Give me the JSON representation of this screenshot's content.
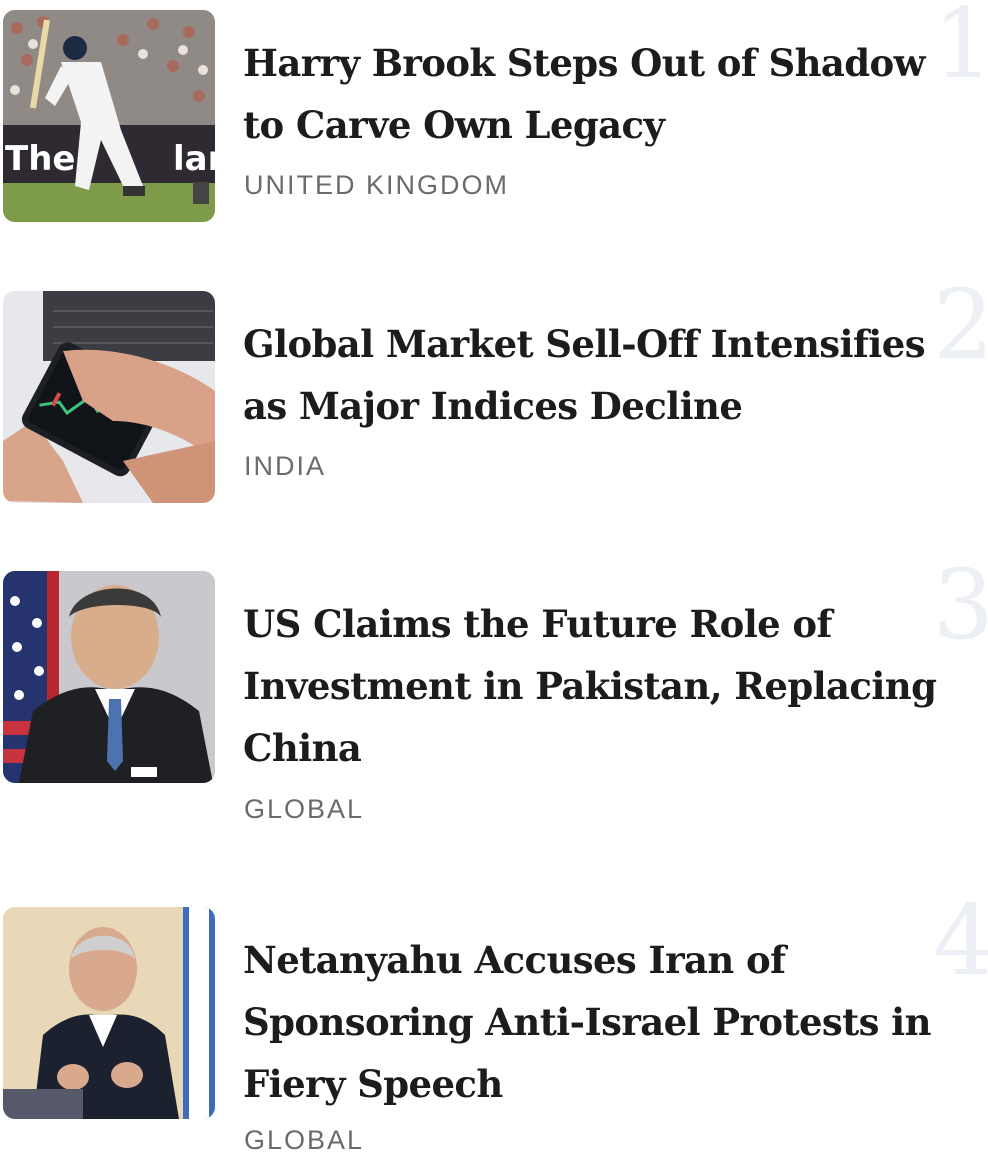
{
  "articles": [
    {
      "rank": "1",
      "headline": "Harry Brook Steps Out of Shadow to Carve Own Legacy",
      "category": "UNITED KINGDOM",
      "image": "cricket-batsman-photo"
    },
    {
      "rank": "2",
      "headline": "Global Market Sell-Off Intensifies as Major Indices Decline",
      "category": "INDIA",
      "image": "stock-chart-phone-photo"
    },
    {
      "rank": "3",
      "headline": "US Claims the Future Role of Investment in Pakistan, Replacing China",
      "category": "GLOBAL",
      "image": "diplomat-portrait-photo"
    },
    {
      "rank": "4",
      "headline": "Netanyahu Accuses Iran of Sponsoring Anti-Israel Protests in Fiery Speech",
      "category": "GLOBAL",
      "image": "speaker-at-podium-photo"
    }
  ],
  "colors": {
    "headline": "#1c1c1c",
    "category": "#6b6b6b",
    "rank_numeral": "#eceff3",
    "background": "#ffffff"
  }
}
